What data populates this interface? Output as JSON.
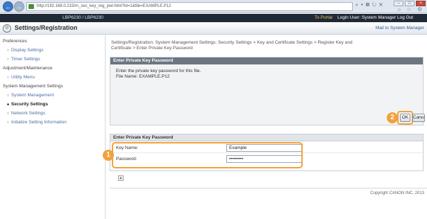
{
  "browser": {
    "address": "http://192.168.0.215/m_sec_key_reg_pwi.html?id=1&file=EXAMPLE.P12",
    "address_tools": "⌕ ▾ ▤ ↻ ✕",
    "right_icons": "⌂ ☆ ⚙"
  },
  "header": {
    "model": "LBP6230 / LBP6230",
    "portal_link": "To Portal",
    "login_user": "Login User: System Manager Log Out"
  },
  "title_bar": {
    "title": "Settings/Registration",
    "mail_link": "Mail to System Manager"
  },
  "sidebar": {
    "items": [
      {
        "label": "Preferences"
      },
      {
        "label": "Display Settings"
      },
      {
        "label": "Timer Settings"
      },
      {
        "label": "Adjustment/Maintenance"
      },
      {
        "label": "Utility Menu"
      },
      {
        "label": "System Management Settings"
      },
      {
        "label": "System Management"
      },
      {
        "label": "Security Settings"
      },
      {
        "label": "Network Settings"
      },
      {
        "label": "Initialize Setting Information"
      }
    ]
  },
  "main": {
    "breadcrumb_line1": "Settings/Registration: System Management Settings: Security Settings > Key and Certificate Settings > Register Key and",
    "breadcrumb_line2": "Certificate > Enter Private Key Password",
    "panel1_title": "Enter Private Key Password",
    "instruction": "Enter the private key password for this file.",
    "file_name": "File Name: EXAMPLE.P12",
    "ok_label": "OK",
    "cancel_label": "Cancel",
    "panel2_title": "Enter Private Key Password",
    "key_name_label": "Key Name:",
    "key_name_value": "Example",
    "password_label": "Password:",
    "password_value": "•••••••••",
    "callout_1": "1",
    "callout_2": "2",
    "top_icon": "▲",
    "copyright": "Copyright CANON INC. 2013"
  },
  "colors": {
    "highlight": "#f0a23c",
    "header_dark": "#1f2a36",
    "panel_header": "#6c7682"
  }
}
